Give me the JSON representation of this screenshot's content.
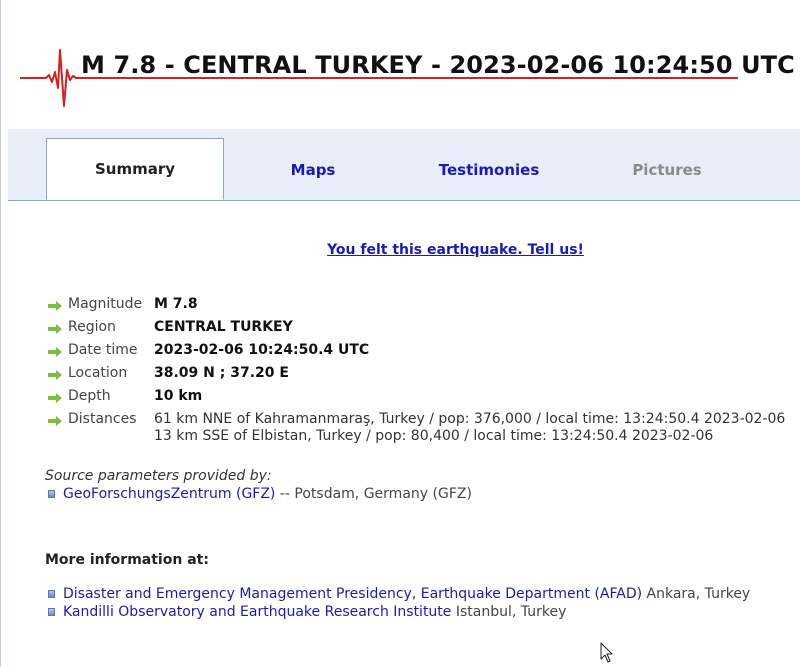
{
  "header": {
    "title": "M 7.8 - CENTRAL TURKEY - 2023-02-06 10:24:50 UTC"
  },
  "tabs": [
    {
      "label": "Summary",
      "state": "active"
    },
    {
      "label": "Maps",
      "state": "link"
    },
    {
      "label": "Testimonies",
      "state": "link"
    },
    {
      "label": "Pictures",
      "state": "disabled"
    }
  ],
  "felt_link": "You felt this earthquake. Tell us!",
  "info": {
    "magnitude": {
      "label": "Magnitude",
      "value": "M 7.8"
    },
    "region": {
      "label": "Region",
      "value": "CENTRAL TURKEY"
    },
    "datetime": {
      "label": "Date time",
      "value": "2023-02-06 10:24:50.4 UTC"
    },
    "location": {
      "label": "Location",
      "value": "38.09 N ; 37.20 E"
    },
    "depth": {
      "label": "Depth",
      "value": "10 km"
    },
    "distances": {
      "label": "Distances",
      "lines": [
        "61 km NNE of Kahramanmaraş, Turkey / pop: 376,000 / local time: 13:24:50.4 2023-02-06",
        "13 km SSE of Elbistan, Turkey / pop: 80,400 / local time: 13:24:50.4 2023-02-06"
      ]
    }
  },
  "source": {
    "heading": "Source parameters provided by:",
    "link": "GeoForschungsZentrum (GFZ)",
    "suffix": "-- Potsdam, Germany (GFZ)"
  },
  "more": {
    "heading": "More information at:",
    "items": [
      {
        "link": "Disaster and Emergency Management Presidency, Earthquake Department (AFAD)",
        "suffix": "Ankara, Turkey"
      },
      {
        "link": "Kandilli Observatory and Earthquake Research Institute",
        "suffix": "Istanbul, Turkey"
      }
    ]
  },
  "colors": {
    "accent_red": "#d42020",
    "link_blue": "#1a1ab8",
    "tab_bar": "#e8eef8",
    "arrow_green": "#7bbf3a"
  },
  "icons": {
    "logo": "seismogram-icon",
    "row_marker": "green-arrow-icon",
    "list_marker": "bullet-icon",
    "pointer": "mouse-cursor-icon"
  }
}
